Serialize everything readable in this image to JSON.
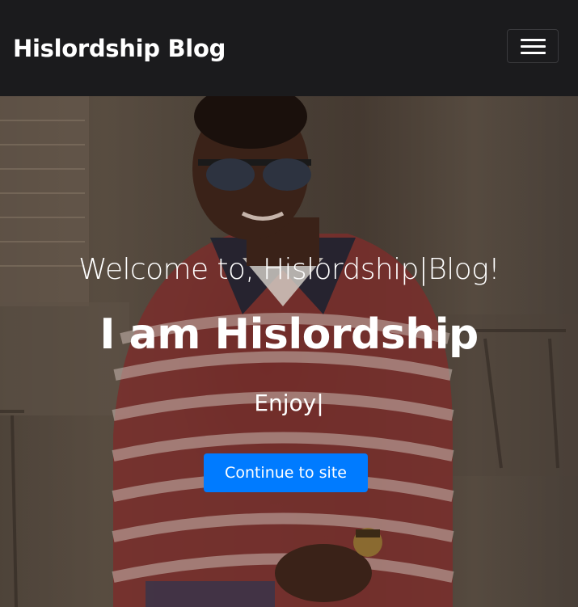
{
  "navbar": {
    "brand": "Hislordship Blog",
    "menu_icon": "hamburger-menu-icon"
  },
  "hero": {
    "background_image": "photo of a smiling man in sunglasses and red-white striped polo shirt",
    "welcome_text": "Welcome to, Hislordship|Blog!",
    "title": "I am Hislordship",
    "typed_text": "Enjoy|",
    "cta_label": "Continue to site"
  },
  "colors": {
    "navbar_bg": "#1b1b1d",
    "cta_bg": "#007bff",
    "text": "#ffffff"
  }
}
